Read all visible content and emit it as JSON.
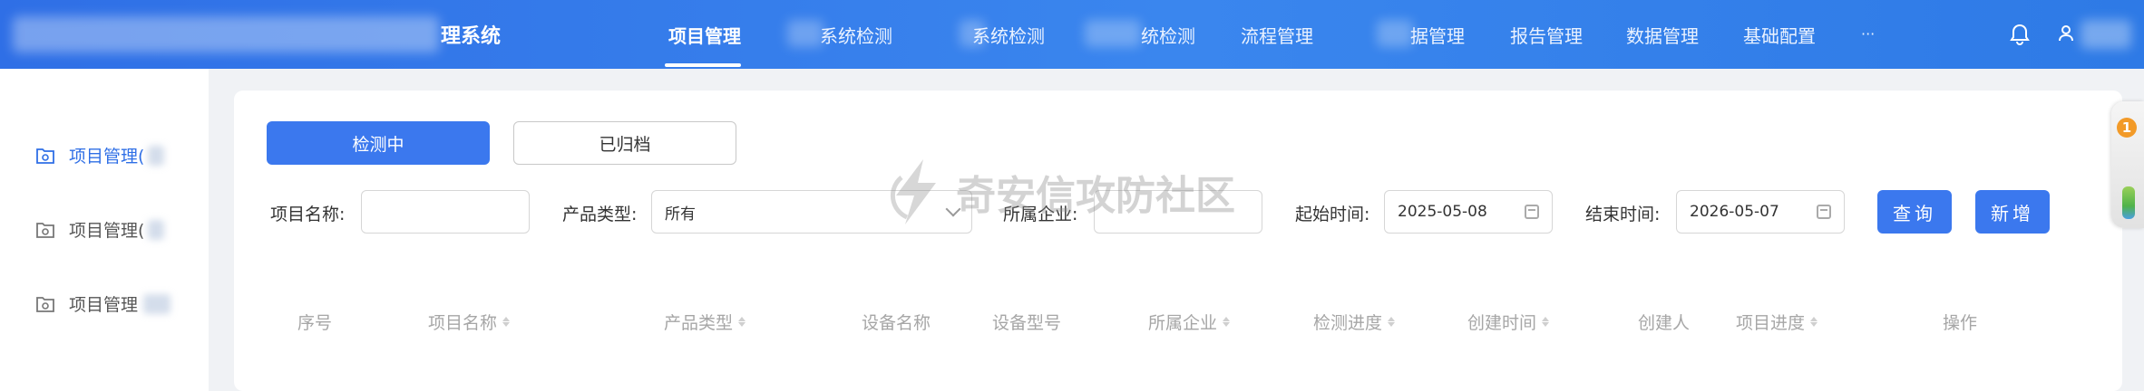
{
  "header": {
    "brand_suffix": "理系统",
    "nav": [
      {
        "label": "项目管理",
        "active": true
      },
      {
        "label": "系统检测"
      },
      {
        "label": "系统检测"
      },
      {
        "label": "统检测"
      },
      {
        "label": "流程管理"
      },
      {
        "label": "据管理"
      },
      {
        "label": "报告管理"
      },
      {
        "label": "数据管理"
      },
      {
        "label": "基础配置"
      },
      {
        "label": "···"
      }
    ],
    "icons": {
      "bell": "bell-icon",
      "user": "user-icon"
    }
  },
  "sidebar": {
    "items": [
      {
        "label": "项目管理(",
        "active": true,
        "icon": "folder-gear-icon"
      },
      {
        "label": "项目管理(",
        "active": false,
        "icon": "folder-gear-icon"
      },
      {
        "label": "项目管理",
        "active": false,
        "icon": "folder-gear-icon"
      }
    ]
  },
  "tabs": {
    "testing": "检测中",
    "archived": "已归档"
  },
  "filters": {
    "project_name_label": "项目名称:",
    "product_type_label": "产品类型:",
    "product_type_value": "所有",
    "company_label": "所属企业:",
    "start_time_label": "起始时间:",
    "start_date": "2025-05-08",
    "end_time_label": "结束时间:",
    "end_date": "2026-05-07",
    "search_button": "查询",
    "add_button": "新增"
  },
  "table": {
    "columns": [
      {
        "label": "序号",
        "sortable": false
      },
      {
        "label": "项目名称",
        "sortable": true
      },
      {
        "label": "产品类型",
        "sortable": true
      },
      {
        "label": "设备名称",
        "sortable": false
      },
      {
        "label": "设备型号",
        "sortable": false
      },
      {
        "label": "所属企业",
        "sortable": true
      },
      {
        "label": "检测进度",
        "sortable": true
      },
      {
        "label": "创建时间",
        "sortable": true
      },
      {
        "label": "创建人",
        "sortable": false
      },
      {
        "label": "项目进度",
        "sortable": true
      },
      {
        "label": "操作",
        "sortable": false
      }
    ]
  },
  "watermark": {
    "text": "奇安信攻防社区"
  },
  "widget": {
    "badge_count": "1"
  },
  "colors": {
    "primary": "#3b78ee",
    "header": "#2f6fe6",
    "badge": "#f29a28"
  }
}
